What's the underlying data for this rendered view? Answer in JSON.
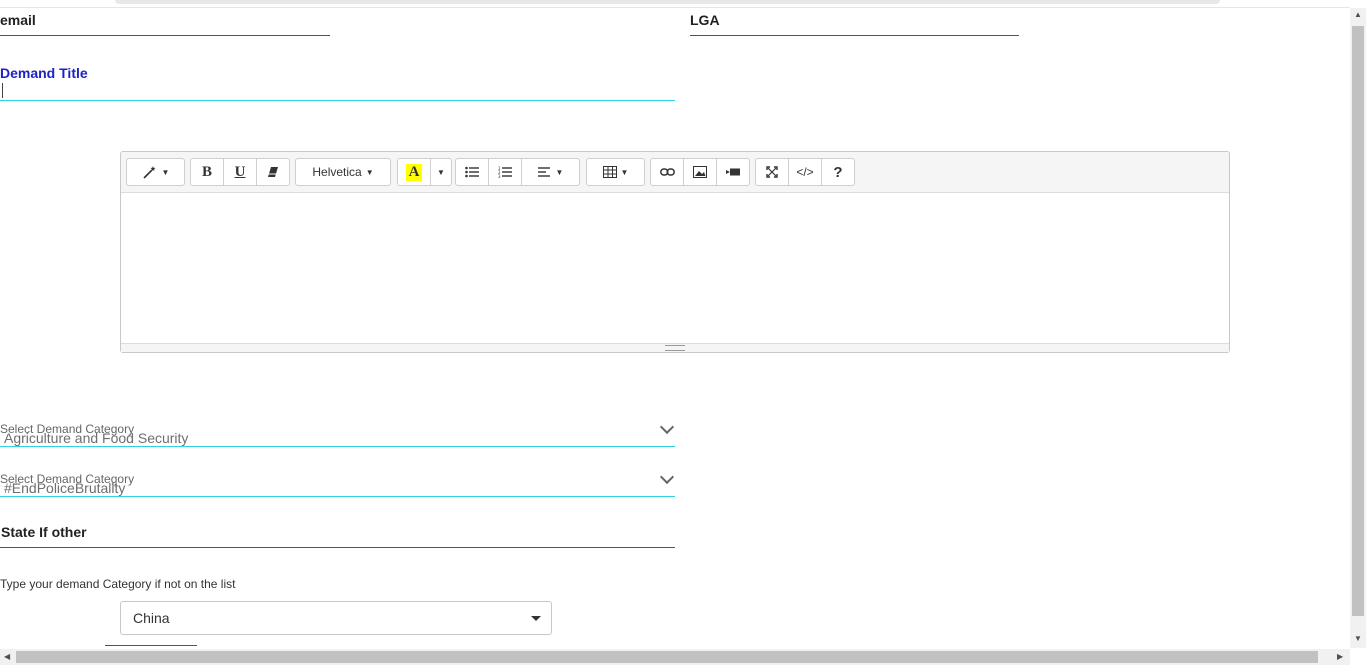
{
  "form": {
    "email_label": "email",
    "lga_label": "LGA",
    "demand_title_label": "Demand Title",
    "demand_title_value": "",
    "category1": {
      "placeholder": "Select Demand Category",
      "value": "Agriculture and Food Security"
    },
    "category2": {
      "placeholder": "Select Demand Category",
      "value": "#EndPoliceBrutality"
    },
    "state_if_other_label": "State If other",
    "category_hint": "Type your demand Category if not on the list",
    "country_value": "China"
  },
  "editor": {
    "toolbar": {
      "style_icon": "magic-wand-icon",
      "bold": "B",
      "underline": "U",
      "eraser_icon": "eraser-icon",
      "font_name": "Helvetica",
      "color_letter": "A",
      "ul_icon": "unordered-list-icon",
      "ol_icon": "ordered-list-icon",
      "align_icon": "align-left-icon",
      "table_icon": "table-icon",
      "link_icon": "link-icon",
      "picture_icon": "picture-icon",
      "video_icon": "video-icon",
      "fullscreen_icon": "expand-icon",
      "code_label": "</>",
      "help_label": "?"
    },
    "content": ""
  },
  "colors": {
    "red_line": "#b52a2a",
    "cyan_line": "#34cfe0",
    "title_blue": "#1d22c4",
    "highlight_yellow": "#ffff00"
  }
}
